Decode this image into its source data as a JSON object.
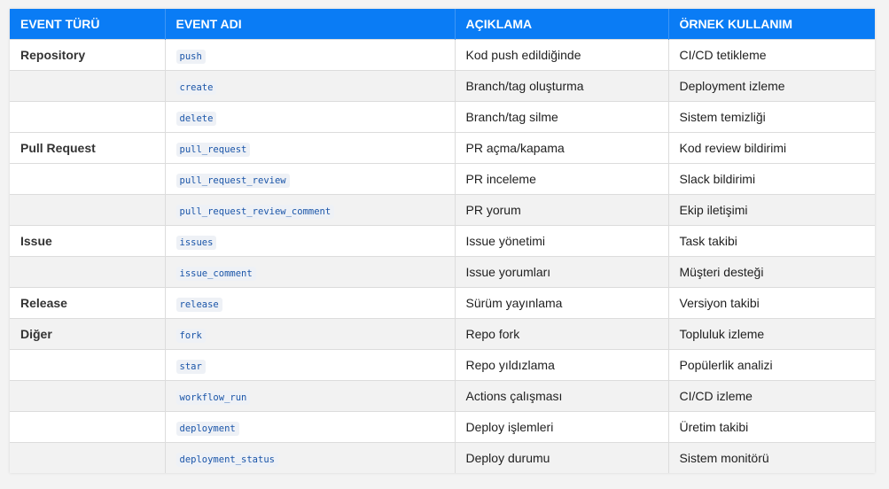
{
  "headers": [
    "EVENT TÜRÜ",
    "EVENT ADI",
    "AÇIKLAMA",
    "ÖRNEK KULLANIM"
  ],
  "rows": [
    {
      "type": "Repository",
      "event": "push",
      "desc": "Kod push edildiğinde",
      "example": "CI/CD tetikleme"
    },
    {
      "type": "",
      "event": "create",
      "desc": "Branch/tag oluşturma",
      "example": "Deployment izleme"
    },
    {
      "type": "",
      "event": "delete",
      "desc": "Branch/tag silme",
      "example": "Sistem temizliği"
    },
    {
      "type": "Pull Request",
      "event": "pull_request",
      "desc": "PR açma/kapama",
      "example": "Kod review bildirimi"
    },
    {
      "type": "",
      "event": "pull_request_review",
      "desc": "PR inceleme",
      "example": "Slack bildirimi"
    },
    {
      "type": "",
      "event": "pull_request_review_comment",
      "desc": "PR yorum",
      "example": "Ekip iletişimi"
    },
    {
      "type": "Issue",
      "event": "issues",
      "desc": "Issue yönetimi",
      "example": "Task takibi"
    },
    {
      "type": "",
      "event": "issue_comment",
      "desc": "Issue yorumları",
      "example": "Müşteri desteği"
    },
    {
      "type": "Release",
      "event": "release",
      "desc": "Sürüm yayınlama",
      "example": "Versiyon takibi"
    },
    {
      "type": "Diğer",
      "event": "fork",
      "desc": "Repo fork",
      "example": "Topluluk izleme"
    },
    {
      "type": "",
      "event": "star",
      "desc": "Repo yıldızlama",
      "example": "Popülerlik analizi"
    },
    {
      "type": "",
      "event": "workflow_run",
      "desc": "Actions çalışması",
      "example": "CI/CD izleme"
    },
    {
      "type": "",
      "event": "deployment",
      "desc": "Deploy işlemleri",
      "example": "Üretim takibi"
    },
    {
      "type": "",
      "event": "deployment_status",
      "desc": "Deploy durumu",
      "example": "Sistem monitörü"
    }
  ],
  "colors": {
    "header_bg": "#0a7cf5",
    "alt_row_bg": "#f2f2f2",
    "code_text": "#1a55a8"
  }
}
